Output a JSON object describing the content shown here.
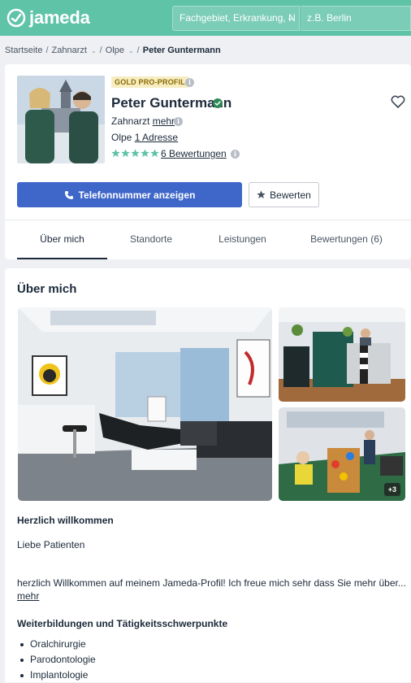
{
  "header": {
    "brand": "jameda",
    "search_specialty": "Fachgebiet, Erkrankung, N",
    "search_location": "z.B. Berlin"
  },
  "breadcrumb": [
    "Startseite",
    "Zahnarzt",
    "Olpe",
    "Peter Guntermann"
  ],
  "profile": {
    "badge": "GOLD PRO-PROFIL",
    "name": "Peter Guntermann",
    "specialty": "Zahnarzt",
    "more_link": "mehr",
    "city": "Olpe",
    "address_link": "1 Adresse",
    "rating": 5,
    "reviews_link": "6 Bewertungen",
    "call_button": "Telefonnummer anzeigen",
    "rate_button": "Bewerten"
  },
  "tabs": [
    {
      "label": "Über mich",
      "active": true
    },
    {
      "label": "Standorte",
      "active": false
    },
    {
      "label": "Leistungen",
      "active": false
    },
    {
      "label": "Bewertungen (6)",
      "active": false
    }
  ],
  "about": {
    "title": "Über mich",
    "more_photos": "+3",
    "welcome_heading": "Herzlich willkommen",
    "greeting": "Liebe Patienten",
    "intro": "herzlich Willkommen auf meinem Jameda-Profil! Ich freue mich sehr dass Sie mehr über...",
    "intro_more": "mehr",
    "training_heading": "Weiterbildungen und Tätigkeitsschwerpunkte",
    "training_items": [
      "Oralchirurgie",
      "Parodontologie",
      "Implantologie"
    ]
  },
  "colors": {
    "brand": "#5fc3a8",
    "primary_button": "#3f67c9",
    "star": "#5fc3a8",
    "gold_badge_bg": "#f7edc2"
  }
}
